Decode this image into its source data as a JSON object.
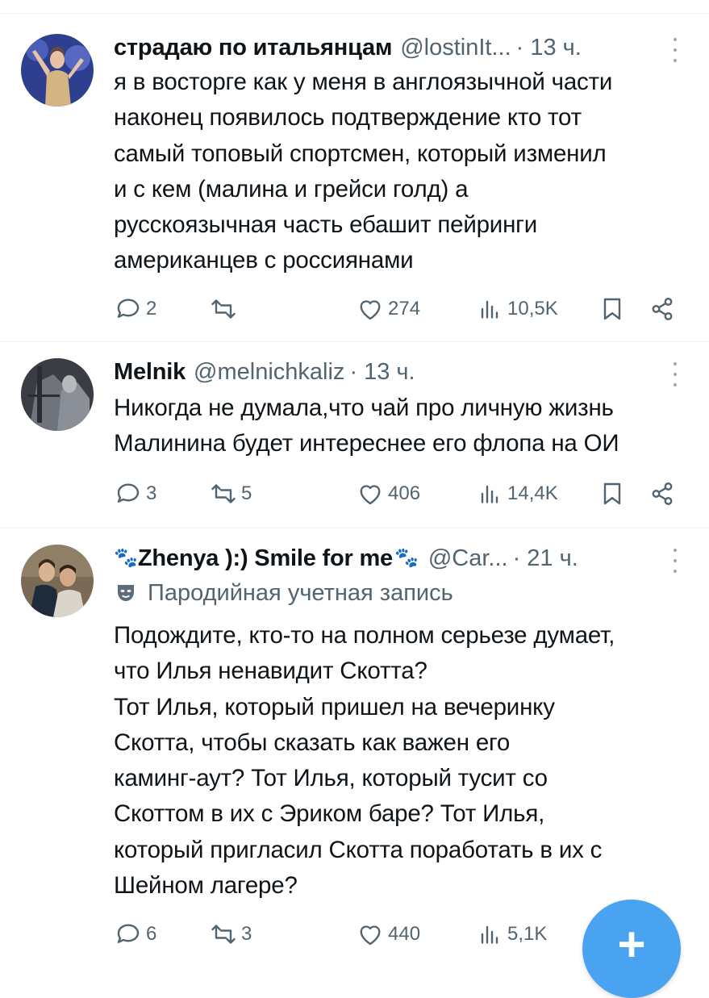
{
  "tweets": [
    {
      "name": "страдаю по итальянцам",
      "handle": "@lostinIt...",
      "time": "13 ч.",
      "lines": [
        "я в восторге как у меня в англоязычной части",
        "наконец появилось подтверждение кто тот",
        "самый топовый спортсмен, который изменил",
        "и с кем (малина и грейси голд) а",
        "русскоязычная часть ебашит пейринги",
        "американцев с россиянами"
      ],
      "replies": "2",
      "retweets": "",
      "likes": "274",
      "views": "10,5K"
    },
    {
      "name": "Melnik",
      "handle": "@melnichkaliz",
      "time": "13 ч.",
      "lines": [
        "Никогда не думала,что чай про личную жизнь",
        "Малинина будет интереснее его флопа на ОИ"
      ],
      "replies": "3",
      "retweets": "5",
      "likes": "406",
      "views": "14,4K"
    },
    {
      "name": "Zhenya ):) Smile for me",
      "name_prefix": "🐾",
      "name_suffix": "🐾",
      "handle": "@Car...",
      "time": "21 ч.",
      "badge": "Пародийная учетная запись",
      "lines": [
        "Подождите, кто-то на полном серьезе думает,",
        "что Илья ненавидит Скотта?",
        "Тот Илья, который пришел на вечеринку",
        "Скотта, чтобы сказать как важен его",
        "каминг-аут? Тот Илья, который тусит со",
        "Скоттом в их с Эриком баре? Тот Илья,",
        "который пригласил Скотта поработать в их с",
        "Шейном лагере?"
      ],
      "replies": "6",
      "retweets": "3",
      "likes": "440",
      "views": "5,1K"
    }
  ],
  "fab": {
    "label": "+"
  },
  "colors": {
    "text": "#0f1419",
    "secondary": "#536471",
    "accent": "#4aa3f0",
    "divider": "#eff3f4"
  },
  "icons": [
    "more-icon",
    "reply-icon",
    "retweet-icon",
    "like-icon",
    "views-icon",
    "bookmark-icon",
    "share-icon",
    "parody-mask-icon",
    "paw-icon",
    "plus-icon"
  ]
}
